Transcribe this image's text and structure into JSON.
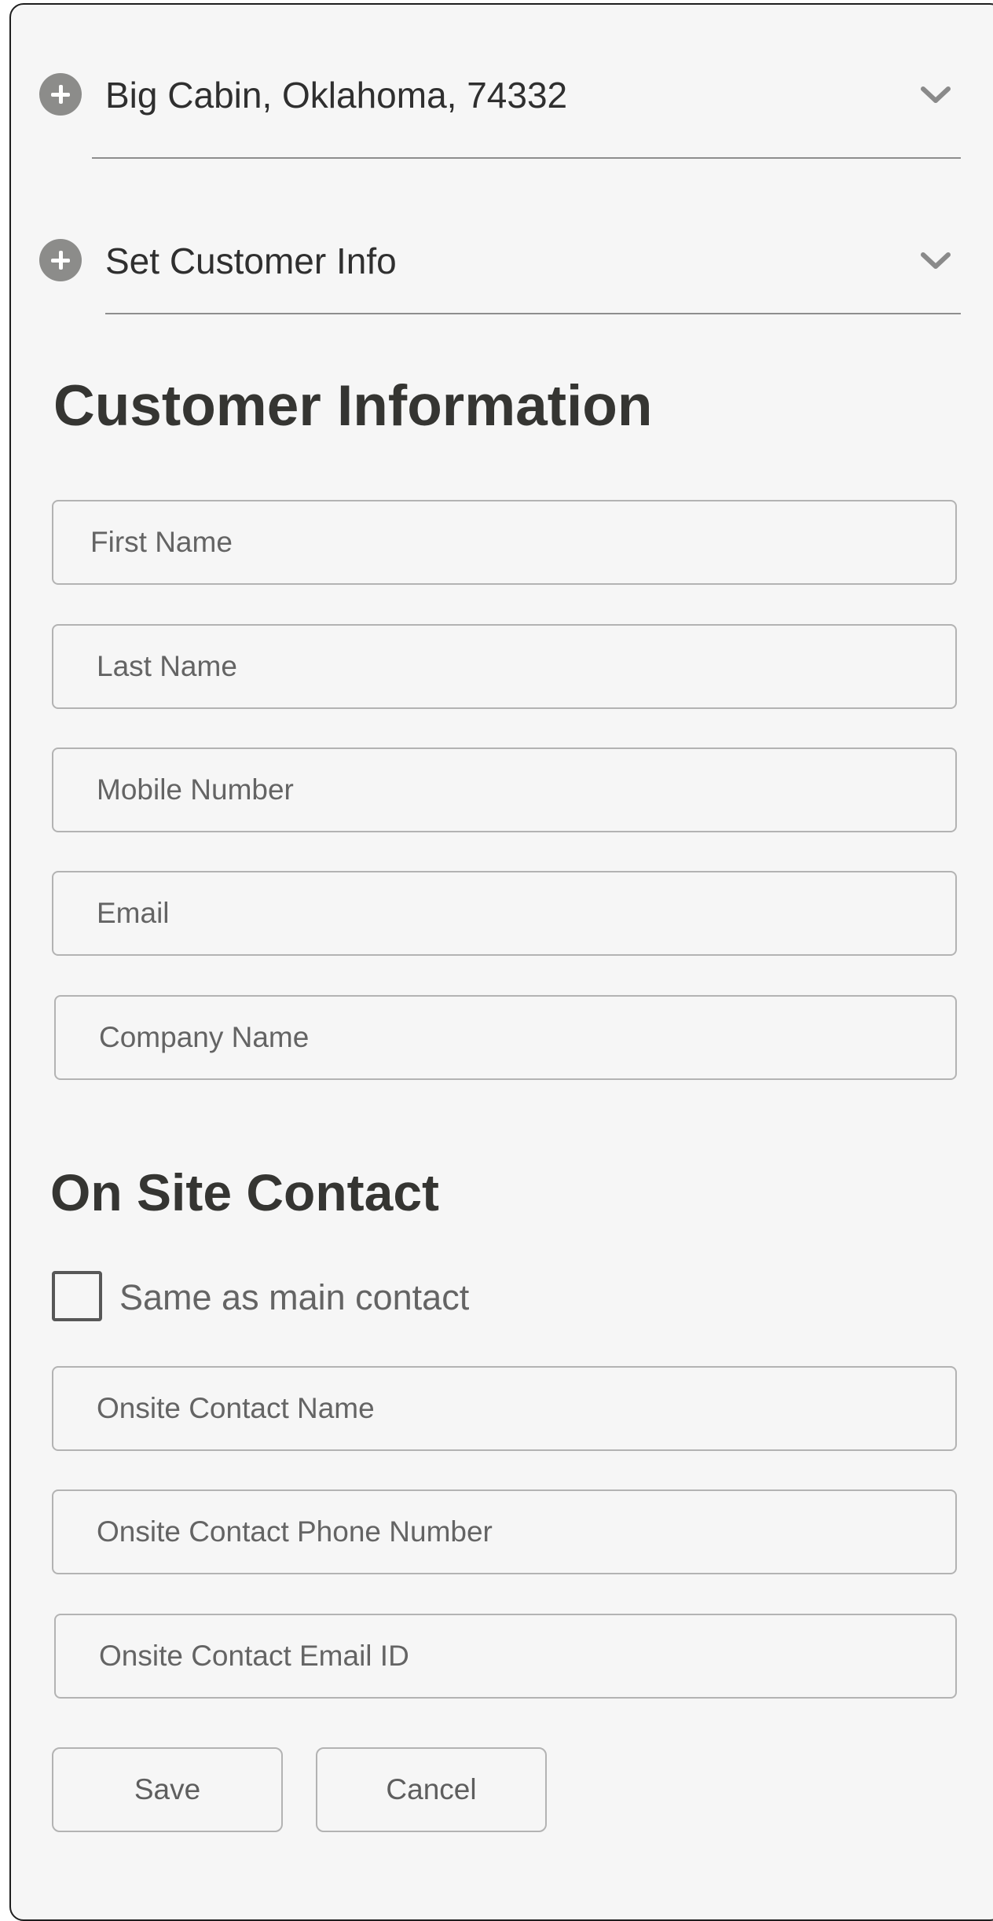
{
  "accordion": [
    {
      "label": "Big Cabin, Oklahoma, 74332",
      "expand_icon": "plus-circle-icon",
      "toggle_icon": "chevron-down-icon"
    },
    {
      "label": "Set Customer Info",
      "expand_icon": "plus-circle-icon",
      "toggle_icon": "chevron-down-icon"
    }
  ],
  "customer_info": {
    "title": "Customer Information",
    "fields": {
      "first_name": {
        "placeholder": "First Name",
        "value": ""
      },
      "last_name": {
        "placeholder": "Last Name",
        "value": ""
      },
      "mobile": {
        "placeholder": "Mobile Number",
        "value": ""
      },
      "email": {
        "placeholder": "Email",
        "value": ""
      },
      "company": {
        "placeholder": "Company Name",
        "value": ""
      }
    }
  },
  "onsite": {
    "title": "On Site Contact",
    "same_as_main": {
      "label": "Same as main contact",
      "checked": false
    },
    "fields": {
      "name": {
        "placeholder": "Onsite Contact Name",
        "value": ""
      },
      "phone": {
        "placeholder": "Onsite Contact Phone Number",
        "value": ""
      },
      "email": {
        "placeholder": "Onsite Contact Email ID",
        "value": ""
      }
    }
  },
  "actions": {
    "save_label": "Save",
    "cancel_label": "Cancel"
  },
  "colors": {
    "background": "#f6f6f6",
    "icon_gray": "#8c8c8a",
    "text_dark": "#353532",
    "placeholder": "#646464",
    "border": "#b3b3b3"
  }
}
